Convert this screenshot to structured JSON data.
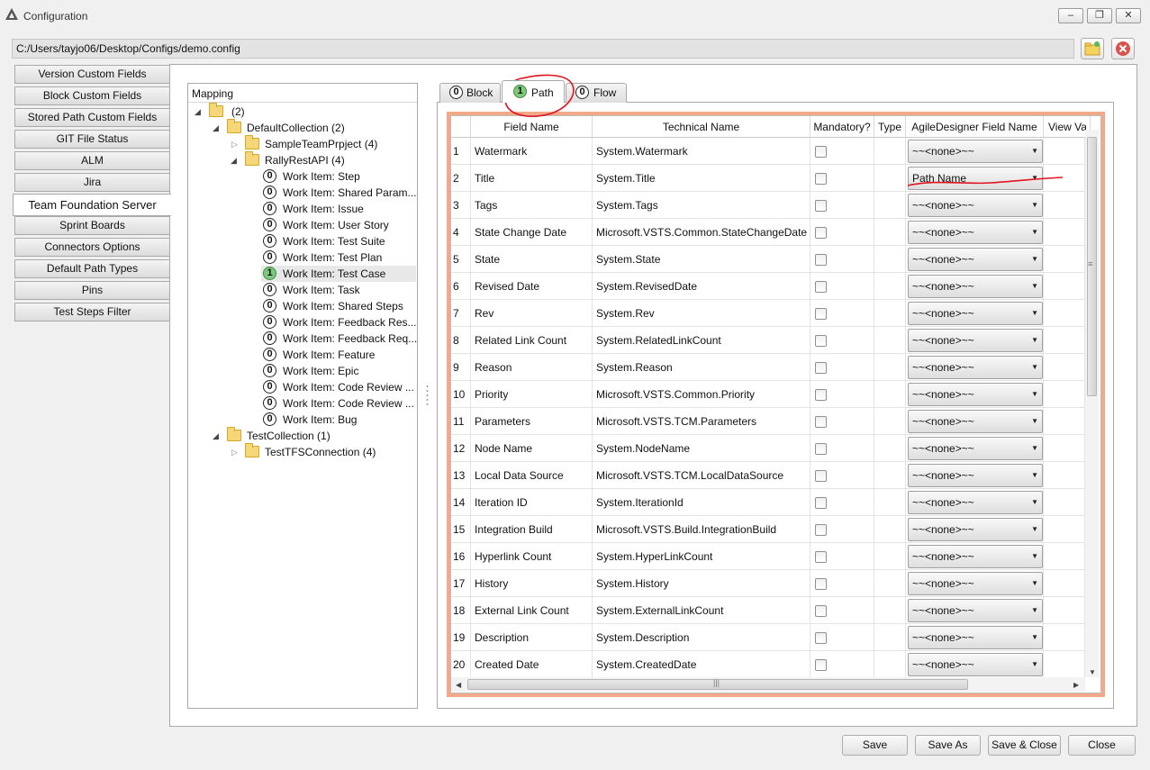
{
  "window": {
    "title": "Configuration",
    "min_label": "–",
    "restore_label": "❐",
    "close_label": "✕"
  },
  "config_path": "C:/Users/tayjo06/Desktop/Configs/demo.config",
  "nav": {
    "items": [
      "Version Custom Fields",
      "Block Custom Fields",
      "Stored Path Custom Fields",
      "GIT File Status",
      "ALM",
      "Jira",
      "Team Foundation Server",
      "Sprint Boards",
      "Connectors Options",
      "Default Path Types",
      "Pins",
      "Test Steps Filter"
    ],
    "active_index": 6
  },
  "mapping": {
    "title": "Mapping",
    "root": {
      "label": "(2)"
    },
    "default_collection": {
      "label": "DefaultCollection (2)"
    },
    "sample_project": {
      "label": "SampleTeamPrpject (4)"
    },
    "rally": {
      "label": "RallyRestAPI (4)"
    },
    "work_items": [
      {
        "count": "0",
        "label": "Work Item: Step"
      },
      {
        "count": "0",
        "label": "Work Item: Shared Param..."
      },
      {
        "count": "0",
        "label": "Work Item: Issue"
      },
      {
        "count": "0",
        "label": "Work Item: User Story"
      },
      {
        "count": "0",
        "label": "Work Item: Test Suite"
      },
      {
        "count": "0",
        "label": "Work Item: Test Plan"
      },
      {
        "count": "1",
        "label": "Work Item: Test Case"
      },
      {
        "count": "0",
        "label": "Work Item: Task"
      },
      {
        "count": "0",
        "label": "Work Item: Shared Steps"
      },
      {
        "count": "0",
        "label": "Work Item: Feedback Res..."
      },
      {
        "count": "0",
        "label": "Work Item: Feedback Req..."
      },
      {
        "count": "0",
        "label": "Work Item: Feature"
      },
      {
        "count": "0",
        "label": "Work Item: Epic"
      },
      {
        "count": "0",
        "label": "Work Item: Code Review ..."
      },
      {
        "count": "0",
        "label": "Work Item: Code Review ..."
      },
      {
        "count": "0",
        "label": "Work Item: Bug"
      }
    ],
    "test_collection": {
      "label": "TestCollection (1)"
    },
    "test_tfs": {
      "label": "TestTFSConnection (4)"
    }
  },
  "tabs": [
    {
      "count": "0",
      "label": "Block"
    },
    {
      "count": "1",
      "label": "Path"
    },
    {
      "count": "0",
      "label": "Flow"
    }
  ],
  "grid": {
    "headers": [
      "Field Name",
      "Technical Name",
      "Mandatory?",
      "Type",
      "AgileDesigner Field Name",
      "View Va"
    ],
    "rows": [
      {
        "n": "1",
        "field": "Watermark",
        "tech": "System.Watermark",
        "mapped": "~~<none>~~"
      },
      {
        "n": "2",
        "field": "Title",
        "tech": "System.Title",
        "mapped": "Path Name"
      },
      {
        "n": "3",
        "field": "Tags",
        "tech": "System.Tags",
        "mapped": "~~<none>~~"
      },
      {
        "n": "4",
        "field": "State Change Date",
        "tech": "Microsoft.VSTS.Common.StateChangeDate",
        "mapped": "~~<none>~~"
      },
      {
        "n": "5",
        "field": "State",
        "tech": "System.State",
        "mapped": "~~<none>~~"
      },
      {
        "n": "6",
        "field": "Revised Date",
        "tech": "System.RevisedDate",
        "mapped": "~~<none>~~"
      },
      {
        "n": "7",
        "field": "Rev",
        "tech": "System.Rev",
        "mapped": "~~<none>~~"
      },
      {
        "n": "8",
        "field": "Related Link Count",
        "tech": "System.RelatedLinkCount",
        "mapped": "~~<none>~~"
      },
      {
        "n": "9",
        "field": "Reason",
        "tech": "System.Reason",
        "mapped": "~~<none>~~"
      },
      {
        "n": "10",
        "field": "Priority",
        "tech": "Microsoft.VSTS.Common.Priority",
        "mapped": "~~<none>~~"
      },
      {
        "n": "11",
        "field": "Parameters",
        "tech": "Microsoft.VSTS.TCM.Parameters",
        "mapped": "~~<none>~~"
      },
      {
        "n": "12",
        "field": "Node Name",
        "tech": "System.NodeName",
        "mapped": "~~<none>~~"
      },
      {
        "n": "13",
        "field": "Local Data Source",
        "tech": "Microsoft.VSTS.TCM.LocalDataSource",
        "mapped": "~~<none>~~"
      },
      {
        "n": "14",
        "field": "Iteration ID",
        "tech": "System.IterationId",
        "mapped": "~~<none>~~"
      },
      {
        "n": "15",
        "field": "Integration Build",
        "tech": "Microsoft.VSTS.Build.IntegrationBuild",
        "mapped": "~~<none>~~"
      },
      {
        "n": "16",
        "field": "Hyperlink Count",
        "tech": "System.HyperLinkCount",
        "mapped": "~~<none>~~"
      },
      {
        "n": "17",
        "field": "History",
        "tech": "System.History",
        "mapped": "~~<none>~~"
      },
      {
        "n": "18",
        "field": "External Link Count",
        "tech": "System.ExternalLinkCount",
        "mapped": "~~<none>~~"
      },
      {
        "n": "19",
        "field": "Description",
        "tech": "System.Description",
        "mapped": "~~<none>~~"
      },
      {
        "n": "20",
        "field": "Created Date",
        "tech": "System.CreatedDate",
        "mapped": "~~<none>~~"
      }
    ]
  },
  "buttons": {
    "save": "Save",
    "save_as": "Save As",
    "save_close": "Save & Close",
    "close": "Close"
  },
  "icons": {
    "app": "app-logo-icon",
    "open_folder": "open-folder-icon",
    "close_file": "close-circle-icon"
  },
  "colors": {
    "highlight_frame": "#f2a98a",
    "annotation": "#e0141e",
    "badge_active": "#7fc97f"
  }
}
